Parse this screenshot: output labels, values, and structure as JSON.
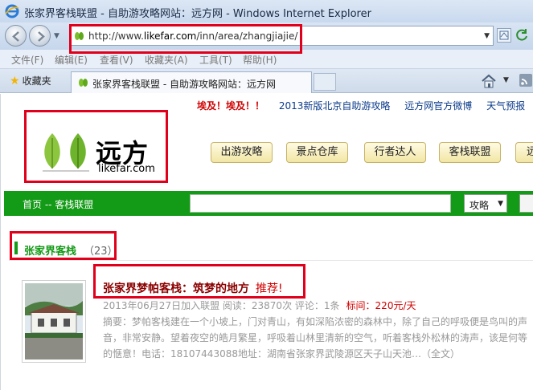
{
  "browser": {
    "window_title": "张家界客栈联盟 - 自助游攻略网站：远方网 - Windows Internet Explorer",
    "url_prefix": "http://www.",
    "url_domain": "likefar.com",
    "url_path": "/inn/area/zhangjiajie/",
    "menu": [
      "文件(F)",
      "编辑(E)",
      "查看(V)",
      "收藏夹(A)",
      "工具(T)",
      "帮助(H)"
    ],
    "favorites_label": "收藏夹",
    "tab_title": "张家界客栈联盟 - 自助游攻略网站：远方网"
  },
  "site": {
    "top_warn": "埃及！埃及！！",
    "top_links": [
      "2013新版北京自助游攻略",
      "远方网官方微博",
      "天气预报"
    ],
    "logo_text": "远方",
    "logo_domain": "likefar.com",
    "nav": [
      "出游攻略",
      "景点仓库",
      "行者达人",
      "客栈联盟",
      "远"
    ],
    "breadcrumb": "首页 -- 客栈联盟",
    "search_type": "攻略",
    "section_name": "张家界客栈",
    "section_count": "（23）",
    "item": {
      "title": "张家界梦帕客栈：筑梦的地方",
      "tag": "推荐!",
      "meta": "2013年06月27日加入联盟    阅读：23870次    评论：1条",
      "price_label": "标间：",
      "price": "220元/天",
      "desc": "摘要：梦帕客栈建在一个小坡上，门对青山，有如深陷浓密的森林中，除了自己的呼吸便是鸟叫的声音，非常安静。望着夜空的皓月繁星，呼吸着山林里清新的空气，听着客栈外松林的涛声，该是何等的惬意！电话：18107443088地址：湖南省张家界武陵源区天子山天池",
      "more": "…（全文）"
    }
  },
  "colors": {
    "brand_green": "#139a16",
    "highlight_red": "#e0001b",
    "title_red": "#8b0000"
  }
}
